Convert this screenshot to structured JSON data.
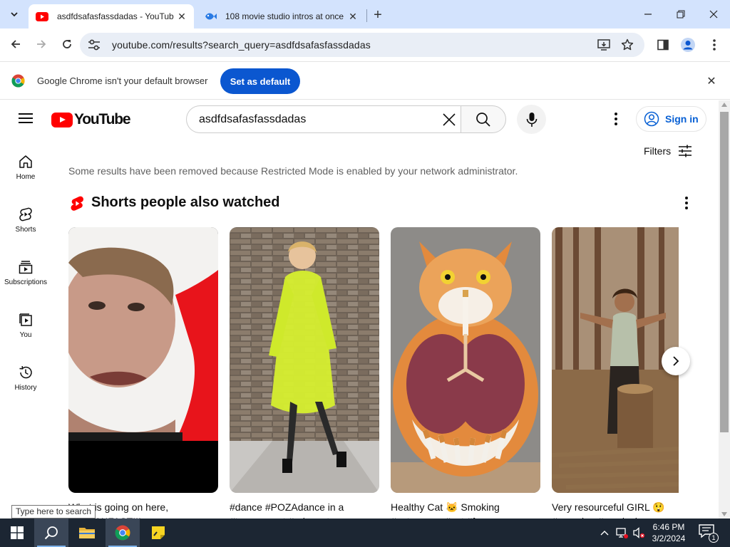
{
  "browser": {
    "tabs": [
      {
        "title": "asdfdsafasfassdadas - YouTube",
        "icon": "youtube-favicon",
        "active": true
      },
      {
        "title": "108 movie studio intros at once",
        "icon": "fish-favicon",
        "active": false
      }
    ],
    "url": "youtube.com/results?search_query=asdfdsafasfassdadas",
    "infobar": {
      "message": "Google Chrome isn't your default browser",
      "button": "Set as default"
    }
  },
  "youtube": {
    "logo_text": "YouTube",
    "search_query": "asdfdsafasfassdadas",
    "sign_in": "Sign in",
    "guide": [
      {
        "label": "Home",
        "icon": "home-icon"
      },
      {
        "label": "Shorts",
        "icon": "shorts-icon"
      },
      {
        "label": "Subscriptions",
        "icon": "subscriptions-icon"
      },
      {
        "label": "You",
        "icon": "you-icon"
      },
      {
        "label": "History",
        "icon": "history-icon"
      }
    ],
    "filters_label": "Filters",
    "restricted_notice": "Some results have been removed because Restricted Mode is enabled by your network administrator.",
    "shelf_title": "Shorts people also watched",
    "shorts": [
      {
        "title": "What is going on here, #BREAKFAST!!!"
      },
      {
        "title": "#dance #POZAdance in a #transparent #raincoat"
      },
      {
        "title": "Healthy Cat 🐱 Smoking #catmemes #cat #funny"
      },
      {
        "title": "Very resourceful GIRL 😲 #camping #survival"
      }
    ]
  },
  "os": {
    "search_tooltip": "Type here to search",
    "time": "6:46 PM",
    "date": "3/2/2024",
    "notification_count": "1"
  },
  "colors": {
    "tabstrip": "#d3e3fd",
    "youtube_red": "#ff0000",
    "link_blue": "#065fd4",
    "chrome_button_blue": "#0b57d0",
    "taskbar": "#1c2633"
  }
}
